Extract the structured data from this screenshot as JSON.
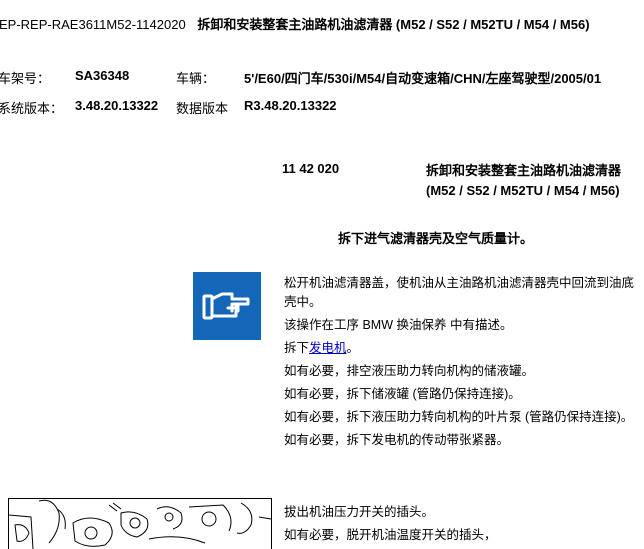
{
  "header": {
    "doc_code": "EP-REP-RAE3611M52-1142020",
    "doc_title": "拆卸和安装整套主油路机油滤清器 (M52 / S52 / M52TU / M54 / M56)"
  },
  "meta": {
    "chassis_label": "车架号：",
    "chassis_value": "SA36348",
    "vehicle_label": "车辆：",
    "vehicle_value": "5'/E60/四门车/530i/M54/自动变速箱/CHN/左座驾驶型/2005/01",
    "system_label": "系统版本：",
    "system_value": "3.48.20.13322",
    "data_label": "数据版本",
    "data_value": "R3.48.20.13322"
  },
  "section": {
    "number": "11 42 020",
    "title": "拆卸和安装整套主油路机油滤清器 (M52 / S52 / M52TU / M54 / M56)"
  },
  "subheading": "拆下进气滤清器壳及空气质量计。",
  "icons": {
    "note": "pointing-hand-note-icon",
    "figure": "engine-illustration"
  },
  "colors": {
    "note_icon_bg": "#1466b8",
    "link": "#0000cc"
  },
  "steps": {
    "s1": "松开机油滤清器盖，使机油从主油路机油滤清器壳中回流到油底壳中。",
    "s2": "该操作在工序 BMW 换油保养 中有描述。",
    "s3_prefix": "拆下",
    "s3_link": "发电机",
    "s3_suffix": "。",
    "s4": "如有必要，排空液压助力转向机构的储液罐。",
    "s5": "如有必要，拆下储液罐 (管路仍保持连接)。",
    "s6": "如有必要，拆下液压助力转向机构的叶片泵 (管路仍保持连接)。",
    "s7": "如有必要，拆下发电机的传动带张紧器。",
    "s8": "拔出机油压力开关的插头。",
    "s9": "如有必要，脱开机油温度开关的插头，"
  }
}
